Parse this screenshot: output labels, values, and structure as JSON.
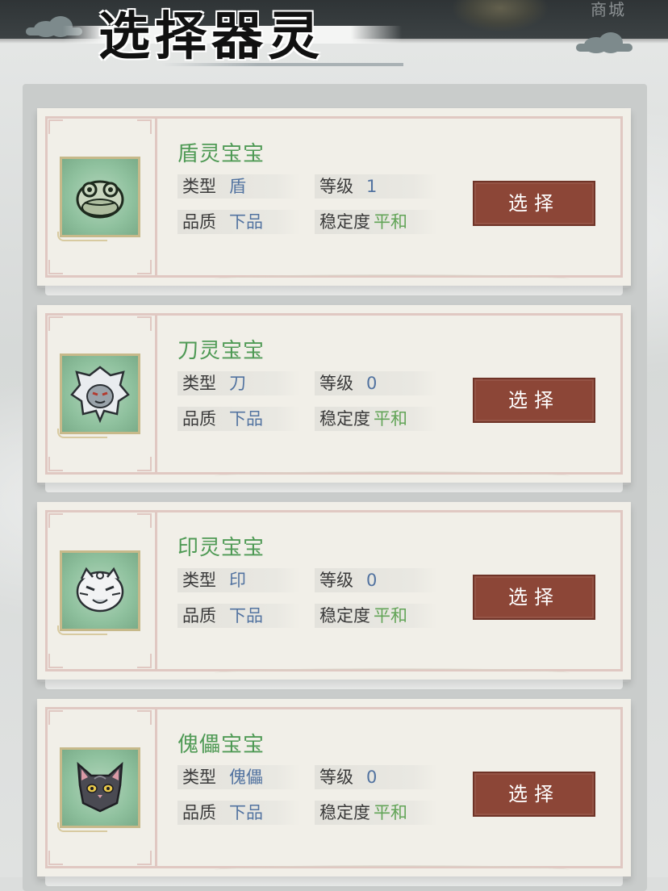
{
  "header": {
    "title": "选择器灵",
    "shop_label": "商城"
  },
  "buttons": {
    "select_label": "选择"
  },
  "labels": {
    "type": "类型",
    "level": "等级",
    "quality": "品质",
    "stability": "稳定度"
  },
  "cards": [
    {
      "name": "盾灵宝宝",
      "type": "盾",
      "level": "1",
      "quality": "下品",
      "stability": "平和",
      "avatar_icon": "frog-spirit-icon"
    },
    {
      "name": "刀灵宝宝",
      "type": "刀",
      "level": "0",
      "quality": "下品",
      "stability": "平和",
      "avatar_icon": "wolf-spirit-icon"
    },
    {
      "name": "印灵宝宝",
      "type": "印",
      "level": "0",
      "quality": "下品",
      "stability": "平和",
      "avatar_icon": "tiger-spirit-icon"
    },
    {
      "name": "傀儡宝宝",
      "type": "傀儡",
      "level": "0",
      "quality": "下品",
      "stability": "平和",
      "avatar_icon": "cat-spirit-icon"
    }
  ],
  "colors": {
    "name_green": "#4f9a55",
    "value_blue": "#5273a0",
    "stability_green": "#62a457",
    "button_brown": "#8c4637"
  }
}
